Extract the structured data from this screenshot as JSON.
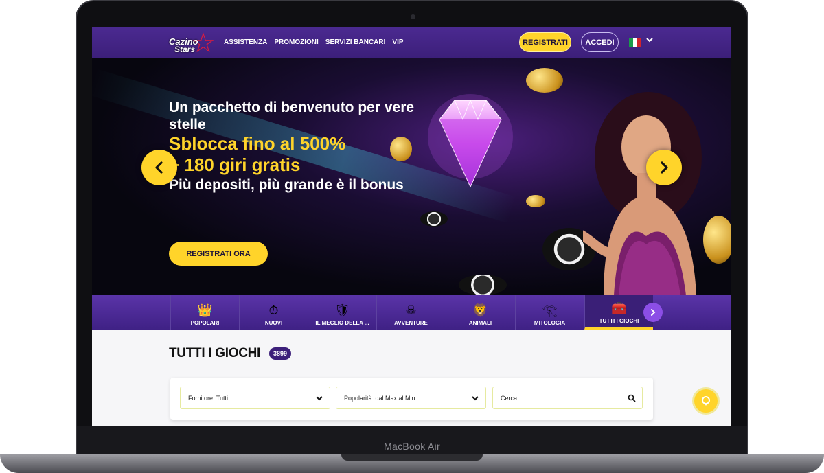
{
  "device": {
    "brand": "MacBook Air"
  },
  "header": {
    "logo_line1": "Cazino",
    "logo_line2": "Stars",
    "nav": [
      "ASSISTENZA",
      "PROMOZIONI",
      "SERVIZI BANCARI",
      "VIP"
    ],
    "register_label": "REGISTRATI",
    "login_label": "ACCEDI",
    "language_flag": "flag-italy-icon"
  },
  "hero": {
    "line1": "Un pacchetto di benvenuto per vere stelle",
    "line2": "Sblocca fino al 500%",
    "line3": "+ 180 giri gratis",
    "line4": "Più depositi, più grande è il bonus",
    "cta_label": "REGISTRATI ORA",
    "slides_total": 7,
    "active_slide": 1
  },
  "categories": [
    {
      "label": "POPOLARI",
      "icon": "crown-icon"
    },
    {
      "label": "NUOVI",
      "icon": "stopwatch-icon"
    },
    {
      "label": "IL MEGLIO DELLA ...",
      "icon": "shield-badge-icon"
    },
    {
      "label": "AVVENTURE",
      "icon": "pirate-skull-icon"
    },
    {
      "label": "ANIMALI",
      "icon": "lion-icon"
    },
    {
      "label": "MITOLOGIA",
      "icon": "pharaoh-icon"
    },
    {
      "label": "TUTTI I GIOCHI",
      "icon": "treasure-chest-icon",
      "active": true
    }
  ],
  "games": {
    "title": "TUTTI I GIOCHI",
    "count": "3899",
    "provider_filter": "Fornitore: Tutti",
    "sort_filter": "Popolarità: dal Max al Min",
    "search_placeholder": "Cerca ..."
  },
  "colors": {
    "accent": "#ffd42a",
    "brand_purple": "#3c1f7a",
    "logo_red": "#e21b3b"
  }
}
